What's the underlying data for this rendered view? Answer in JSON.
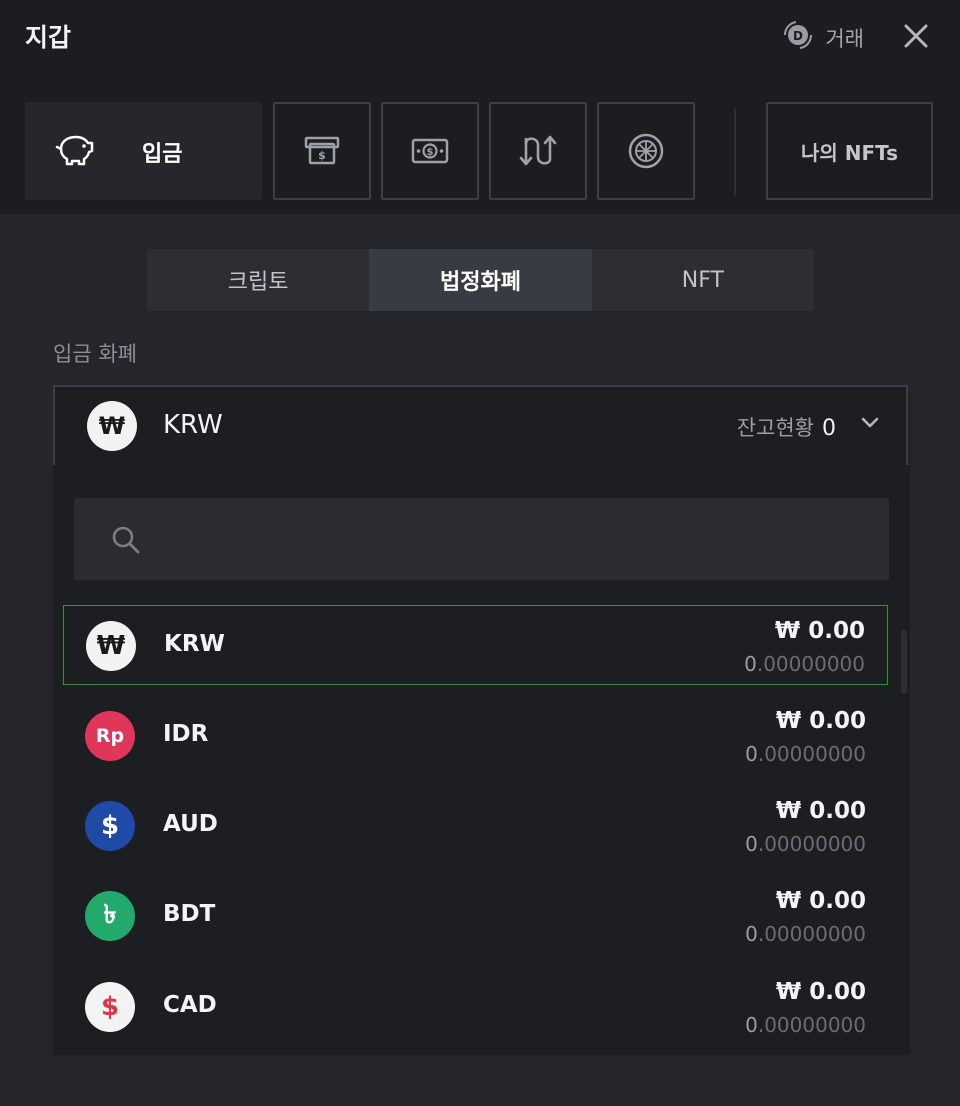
{
  "header": {
    "title": "지갑",
    "trade_label": "거래",
    "icons": {
      "trade": "trade-coin-icon",
      "close": "close-icon"
    }
  },
  "actions": {
    "deposit_label": "입금",
    "icon_buttons": [
      "withdraw-icon",
      "buy-cash-icon",
      "transfer-icon",
      "staking-icon"
    ],
    "nfts_label": "나의 NFTs"
  },
  "tabs": [
    {
      "label": "크립토",
      "active": false
    },
    {
      "label": "법정화폐",
      "active": true
    },
    {
      "label": "NFT",
      "active": false
    }
  ],
  "currency_field": {
    "label": "입금 화폐",
    "selected_code": "KRW",
    "selected_symbol": "₩",
    "balance_label": "잔고현황",
    "balance_value": "0"
  },
  "search": {
    "placeholder": ""
  },
  "currencies": [
    {
      "code": "KRW",
      "symbol": "₩",
      "color": "#f2f2f3",
      "symbol_color": "#1a1a1a",
      "amount": "₩ 0.00",
      "sub_lead": "0",
      "sub_rest": ".00000000",
      "selected": true
    },
    {
      "code": "IDR",
      "symbol": "Rp",
      "color": "#e0365a",
      "symbol_color": "#ffffff",
      "amount": "₩ 0.00",
      "sub_lead": "0",
      "sub_rest": ".00000000",
      "selected": false
    },
    {
      "code": "AUD",
      "symbol": "$",
      "color": "#1f4aa8",
      "symbol_color": "#ffffff",
      "amount": "₩ 0.00",
      "sub_lead": "0",
      "sub_rest": ".00000000",
      "selected": false
    },
    {
      "code": "BDT",
      "symbol": "৳",
      "color": "#22a96c",
      "symbol_color": "#ffffff",
      "amount": "₩ 0.00",
      "sub_lead": "0",
      "sub_rest": ".00000000",
      "selected": false
    },
    {
      "code": "CAD",
      "symbol": "$",
      "color": "#f3f3f4",
      "symbol_color": "#e23347",
      "amount": "₩ 0.00",
      "sub_lead": "0",
      "sub_rest": ".00000000",
      "selected": false
    }
  ]
}
